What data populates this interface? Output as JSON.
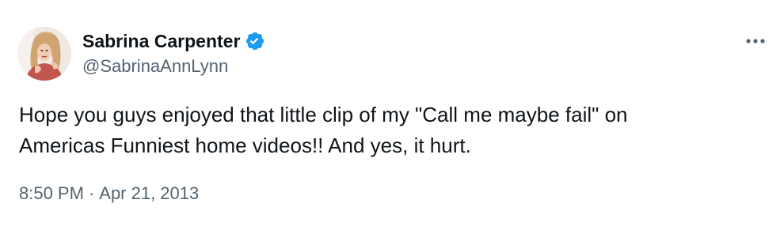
{
  "author": {
    "display_name": "Sabrina Carpenter",
    "handle": "@SabrinaAnnLynn",
    "verified": true,
    "avatar": "profile-photo"
  },
  "tweet": {
    "text_lines": [
      "Hope you guys enjoyed that little clip of my \"Call me maybe fail\" on",
      "Americas Funniest home videos!! And yes, it hurt."
    ],
    "time": "8:50 PM",
    "separator": "·",
    "date": "Apr 21, 2013"
  },
  "icons": {
    "verified": "verified-badge-icon",
    "more": "more-options-icon"
  },
  "colors": {
    "text_primary": "#0f1419",
    "text_secondary": "#536471",
    "verified_blue": "#1d9bf0",
    "background": "#ffffff"
  }
}
